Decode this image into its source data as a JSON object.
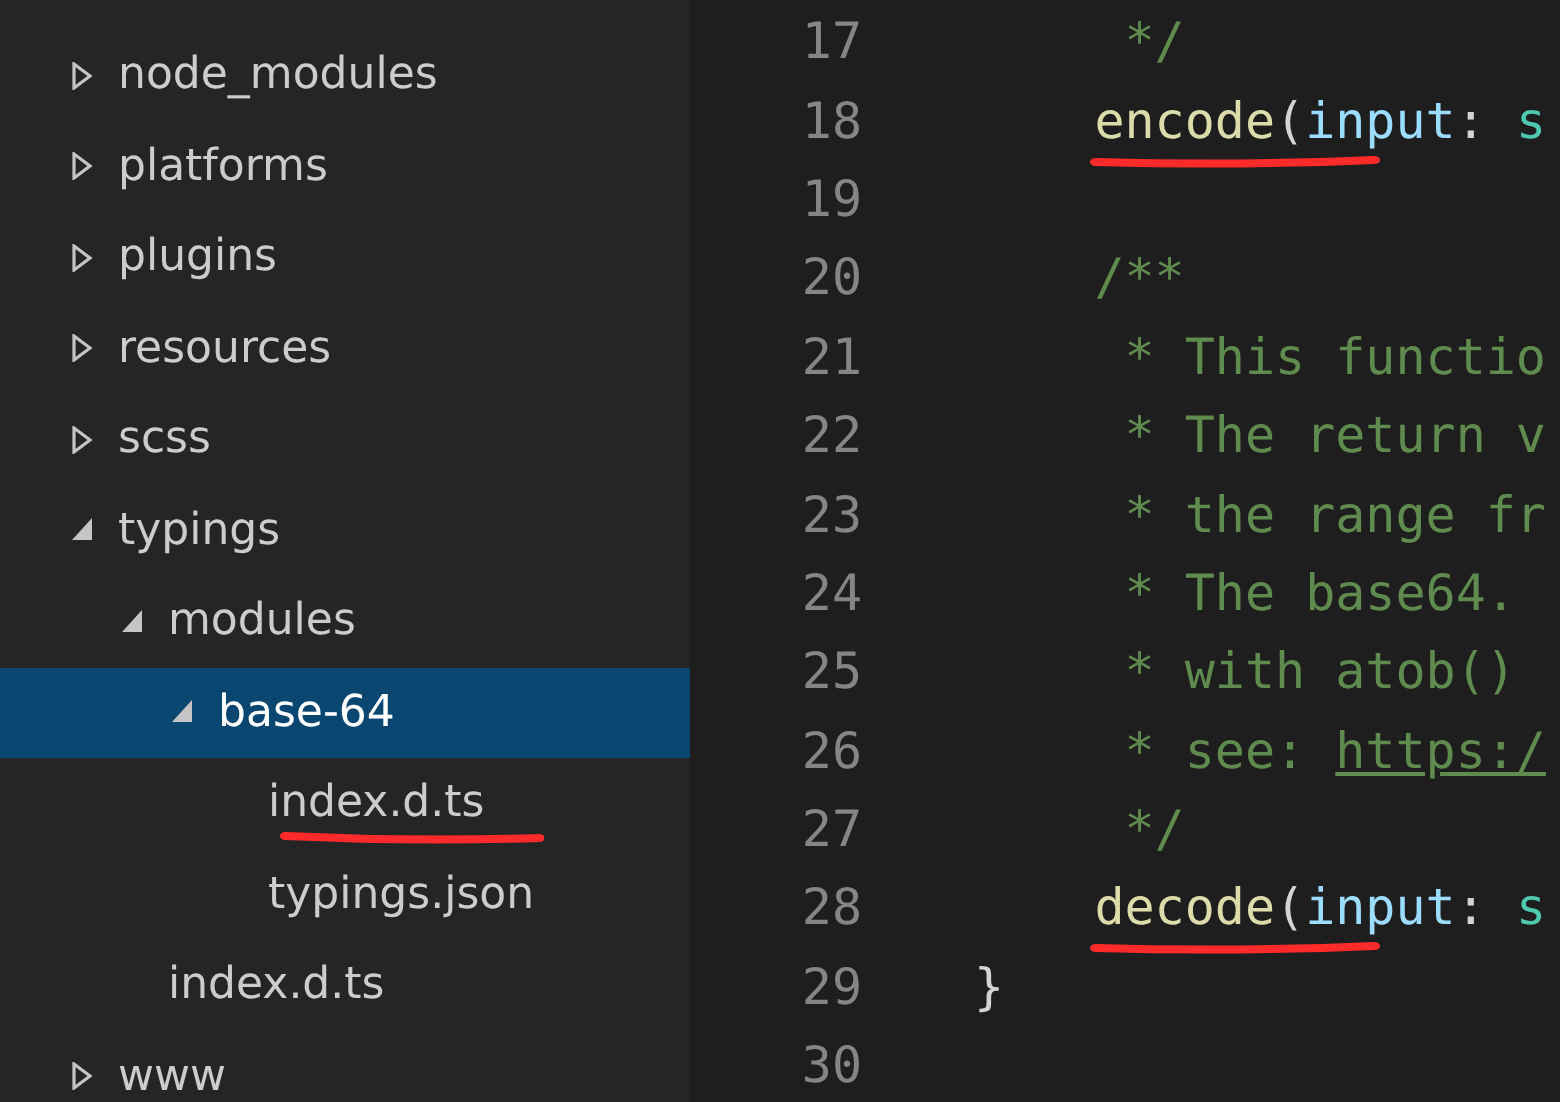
{
  "explorer": {
    "items": [
      {
        "label": "node_modules",
        "kind": "folder",
        "expanded": false,
        "selected": false,
        "underlined": false
      },
      {
        "label": "platforms",
        "kind": "folder",
        "expanded": false,
        "selected": false,
        "underlined": false
      },
      {
        "label": "plugins",
        "kind": "folder",
        "expanded": false,
        "selected": false,
        "underlined": false
      },
      {
        "label": "resources",
        "kind": "folder",
        "expanded": false,
        "selected": false,
        "underlined": false
      },
      {
        "label": "scss",
        "kind": "folder",
        "expanded": false,
        "selected": false,
        "underlined": false
      },
      {
        "label": "typings",
        "kind": "folder",
        "expanded": true,
        "selected": false,
        "underlined": false,
        "children": [
          {
            "label": "modules",
            "kind": "folder",
            "expanded": true,
            "selected": false,
            "underlined": false,
            "children": [
              {
                "label": "base-64",
                "kind": "folder",
                "expanded": true,
                "selected": true,
                "underlined": false,
                "children": [
                  {
                    "label": "index.d.ts",
                    "kind": "file",
                    "selected": false,
                    "underlined": true
                  },
                  {
                    "label": "typings.json",
                    "kind": "file",
                    "selected": false,
                    "underlined": false
                  }
                ]
              }
            ]
          },
          {
            "label": "index.d.ts",
            "kind": "file",
            "selected": false,
            "underlined": false
          }
        ]
      },
      {
        "label": "www",
        "kind": "folder",
        "expanded": false,
        "selected": false,
        "underlined": false
      }
    ]
  },
  "editor": {
    "lines": [
      {
        "number": "17",
        "underlined": false,
        "tokens": [
          {
            "text": "     */",
            "kind": "comment"
          }
        ]
      },
      {
        "number": "18",
        "underlined": true,
        "tokens": [
          {
            "text": "    encode",
            "kind": "function"
          },
          {
            "text": "(",
            "kind": "plain"
          },
          {
            "text": "input",
            "kind": "param"
          },
          {
            "text": ": ",
            "kind": "plain"
          },
          {
            "text": "s",
            "kind": "type"
          }
        ]
      },
      {
        "number": "19",
        "underlined": false
      },
      {
        "number": "20",
        "underlined": false,
        "tokens": [
          {
            "text": "    /**",
            "kind": "comment"
          }
        ]
      },
      {
        "number": "21",
        "underlined": false,
        "tokens": [
          {
            "text": "     * This functio",
            "kind": "comment"
          }
        ]
      },
      {
        "number": "22",
        "underlined": false,
        "tokens": [
          {
            "text": "     * The return v",
            "kind": "comment"
          }
        ]
      },
      {
        "number": "23",
        "underlined": false,
        "tokens": [
          {
            "text": "     * the range fr",
            "kind": "comment"
          }
        ]
      },
      {
        "number": "24",
        "underlined": false,
        "tokens": [
          {
            "text": "     * The base64.",
            "kind": "comment"
          }
        ]
      },
      {
        "number": "25",
        "underlined": false,
        "tokens": [
          {
            "text": "     * with atob()",
            "kind": "comment"
          }
        ]
      },
      {
        "number": "26",
        "underlined": false,
        "tokens": [
          {
            "text": "     * see: ",
            "kind": "comment"
          },
          {
            "text": "https:/",
            "kind": "link"
          }
        ]
      },
      {
        "number": "27",
        "underlined": false,
        "tokens": [
          {
            "text": "     */",
            "kind": "comment"
          }
        ]
      },
      {
        "number": "28",
        "underlined": true,
        "tokens": [
          {
            "text": "    decode",
            "kind": "function"
          },
          {
            "text": "(",
            "kind": "plain"
          },
          {
            "text": "input",
            "kind": "param"
          },
          {
            "text": ": ",
            "kind": "plain"
          },
          {
            "text": "s",
            "kind": "type"
          }
        ]
      },
      {
        "number": "29",
        "underlined": false,
        "tokens": [
          {
            "text": "}",
            "kind": "plain"
          }
        ]
      },
      {
        "number": "30",
        "underlined": false
      }
    ]
  }
}
